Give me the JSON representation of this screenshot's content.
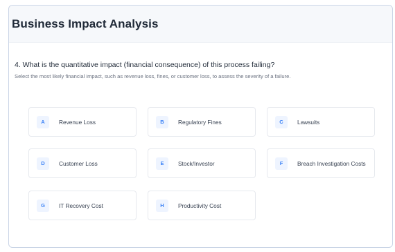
{
  "header": {
    "title": "Business Impact Analysis"
  },
  "question": {
    "text": "4. What is the quantitative impact (financial consequence) of this process failing?",
    "description": "Select the most likely financial impact, such as revenue loss, fines, or customer loss, to assess the severity of a failure."
  },
  "options": [
    {
      "letter": "A",
      "label": "Revenue Loss"
    },
    {
      "letter": "B",
      "label": "Regulatory Fines"
    },
    {
      "letter": "C",
      "label": "Lawsuits"
    },
    {
      "letter": "D",
      "label": "Customer Loss"
    },
    {
      "letter": "E",
      "label": "Stock/Investor"
    },
    {
      "letter": "F",
      "label": "Breach Investigation Costs"
    },
    {
      "letter": "G",
      "label": "IT Recovery Cost"
    },
    {
      "letter": "H",
      "label": "Productivity Cost"
    }
  ],
  "colors": {
    "accent": "#3b82f6",
    "badge_bg": "#eef4ff",
    "border": "#c9d4e6"
  }
}
